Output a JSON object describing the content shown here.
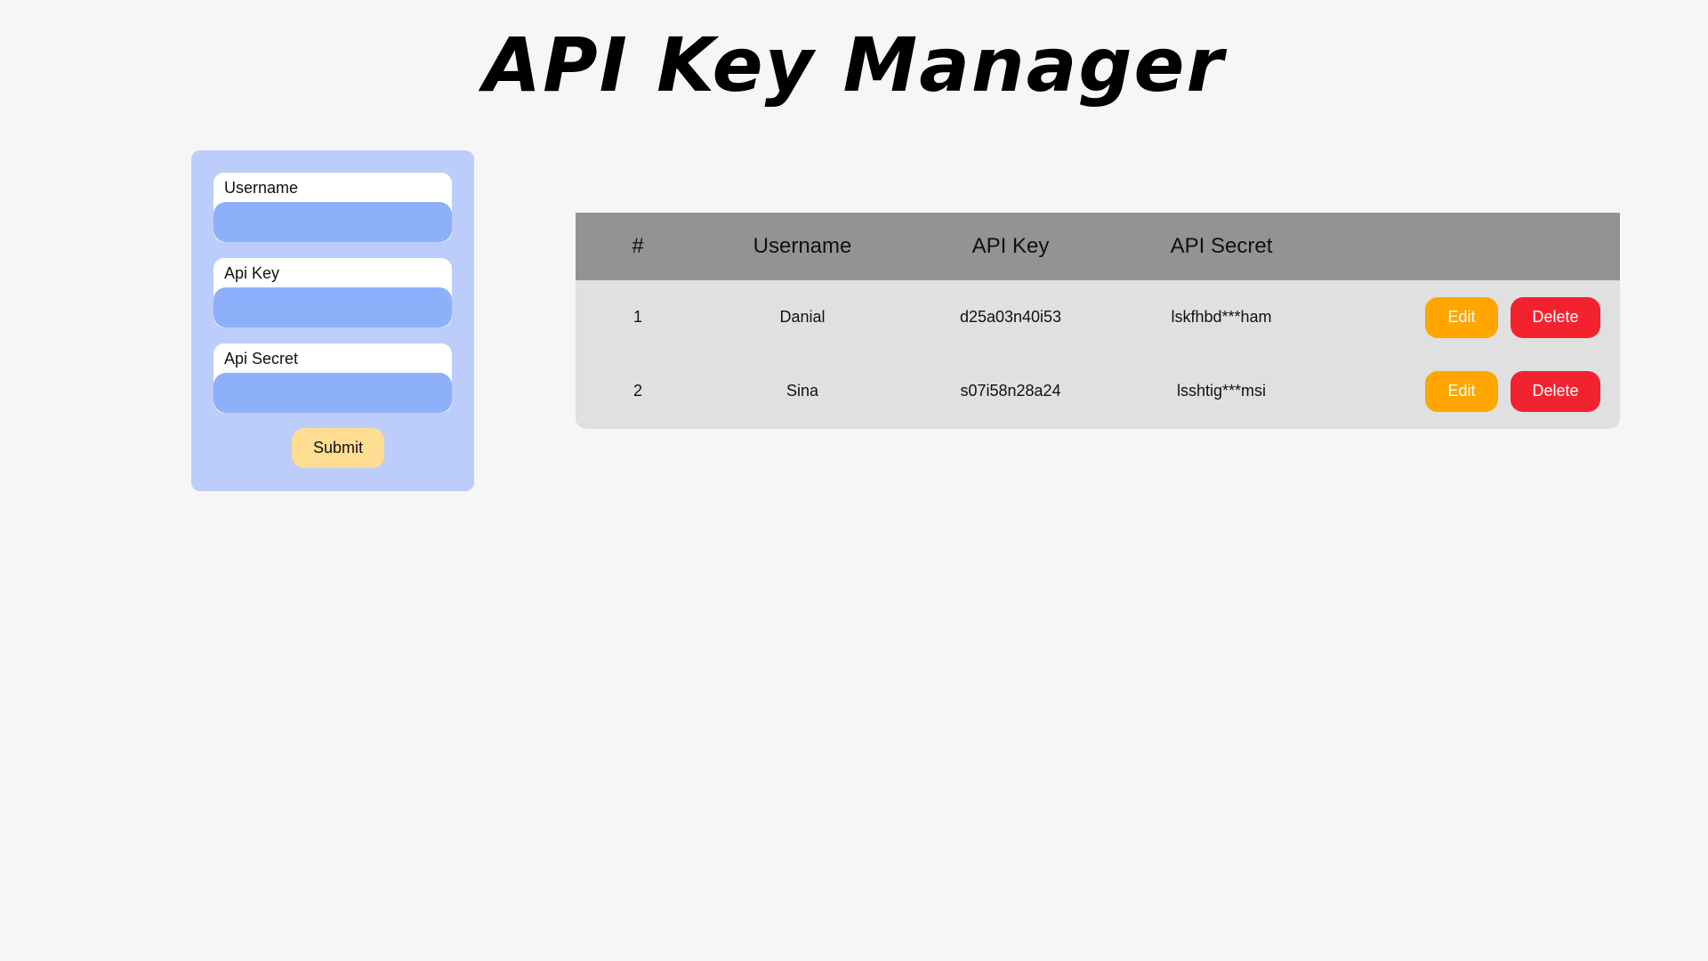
{
  "page": {
    "title": "API Key Manager"
  },
  "form": {
    "fields": [
      {
        "label": "Username",
        "value": ""
      },
      {
        "label": "Api Key",
        "value": ""
      },
      {
        "label": "Api Secret",
        "value": ""
      }
    ],
    "submit_label": "Submit"
  },
  "table": {
    "headers": [
      "#",
      "Username",
      "API Key",
      "API Secret",
      ""
    ],
    "rows": [
      {
        "num": "1",
        "username": "Danial",
        "api_key": "d25a03n40i53",
        "api_secret": "lskfhbd***ham",
        "edit_label": "Edit",
        "delete_label": "Delete"
      },
      {
        "num": "2",
        "username": "Sina",
        "api_key": "s07i58n28a24",
        "api_secret": "lsshtig***msi",
        "edit_label": "Edit",
        "delete_label": "Delete"
      }
    ]
  },
  "colors": {
    "background": "#f6f6f6",
    "form_panel": "#bccdfb",
    "input_fill": "#8eb0fb",
    "submit": "#ffde93",
    "table_header": "#939393",
    "table_body": "#e0e0e0",
    "edit": "#ffa600",
    "delete": "#f2232e"
  }
}
